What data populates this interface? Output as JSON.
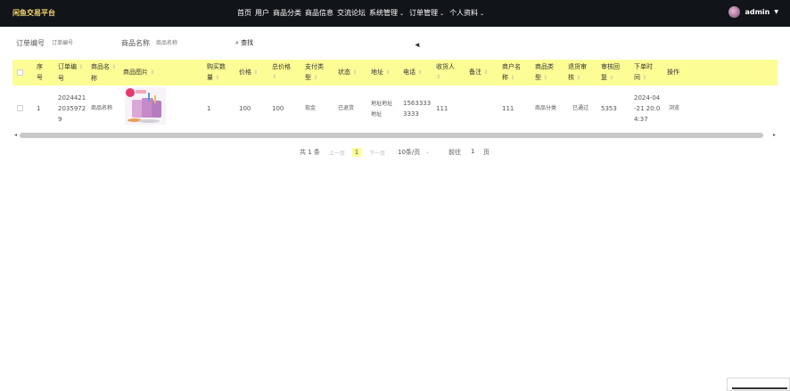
{
  "app": {
    "title": "闲鱼交易平台"
  },
  "nav": {
    "items": [
      "首页",
      "用户",
      "商品分类",
      "商品信息",
      "交流论坛",
      "系统管理",
      "订单管理",
      "个人资料"
    ]
  },
  "user": {
    "name": "admin"
  },
  "search": {
    "order_no_label": "订单编号",
    "order_no_placeholder": "订单编号",
    "goods_name_label": "商品名称",
    "goods_name_placeholder": "商品名称",
    "search_button": "查找"
  },
  "table": {
    "headers": [
      "序号",
      "订单编号",
      "商品名称",
      "商品图片",
      "购买数量",
      "价格",
      "总价格",
      "支付类型",
      "状态",
      "地址",
      "电话",
      "收货人",
      "备注",
      "商户名称",
      "商品类型",
      "退货审核",
      "审核回复",
      "下单时间",
      "操作"
    ],
    "header_lines": [
      [
        "序",
        "号"
      ],
      [
        "订单编",
        "号"
      ],
      [
        "商品名",
        "称"
      ],
      [
        "商品图片"
      ],
      [
        "购买数",
        "量"
      ],
      [
        "价格"
      ],
      [
        "总价格"
      ],
      [
        "支付类",
        "型"
      ],
      [
        "状态"
      ],
      [
        "地址"
      ],
      [
        "电话"
      ],
      [
        "收货人"
      ],
      [
        "备注"
      ],
      [
        "商户名",
        "称"
      ],
      [
        "商品类",
        "型"
      ],
      [
        "退货审",
        "核"
      ],
      [
        "审核回",
        "复"
      ],
      [
        "下单时",
        "间"
      ],
      [
        "操作"
      ]
    ],
    "rows": [
      {
        "index": "1",
        "order_no": [
          "2024421",
          "2035972",
          "9"
        ],
        "goods_name": "商品名称",
        "quantity": "1",
        "price": "100",
        "total": "100",
        "pay_type": "现金",
        "status": "已退货",
        "address": [
          "地址地址",
          "地址"
        ],
        "phone": [
          "1563333",
          "3333"
        ],
        "receiver": "111",
        "remark": "",
        "merchant": "111",
        "goods_type": "商品分类",
        "return_review": "已通过",
        "review_reply": "5353",
        "order_time": [
          "2024-04",
          "-21 20:0",
          "4:37"
        ],
        "action": "浏览"
      }
    ]
  },
  "pager": {
    "total": "共 1 条",
    "prev": "上一页",
    "current": "1",
    "next": "下一页",
    "page_size": "10条/页",
    "goto": "前往",
    "goto_value": "1",
    "page_unit": "页"
  },
  "colors": {
    "topbar": "#111418",
    "brand": "#f5d76e",
    "header_bg": "#fdfd96",
    "passed": "#5bb94a"
  }
}
